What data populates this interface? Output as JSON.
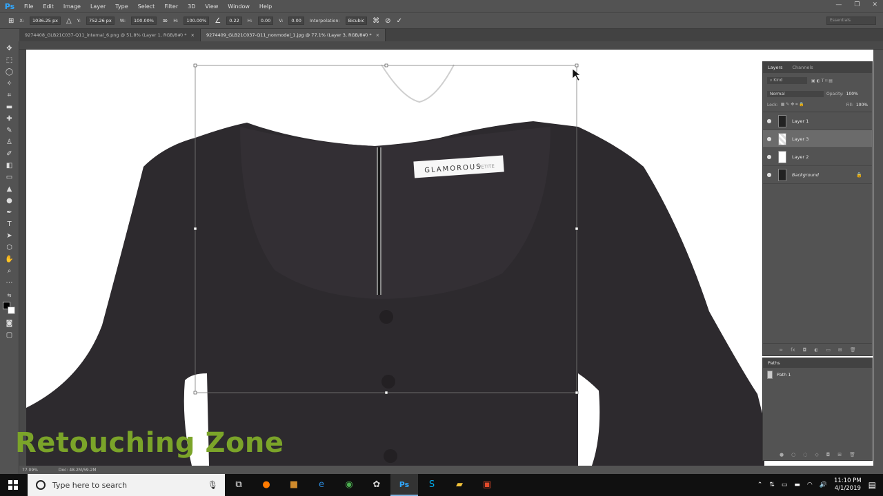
{
  "app": {
    "logo": "Ps",
    "menu": [
      "File",
      "Edit",
      "Image",
      "Layer",
      "Type",
      "Select",
      "Filter",
      "3D",
      "View",
      "Window",
      "Help"
    ],
    "window_controls": [
      "—",
      "❐",
      "✕"
    ]
  },
  "options_bar": {
    "x_label": "X:",
    "x_value": "1036.25 px",
    "y_label": "Y:",
    "y_value": "752.26 px",
    "w_label": "W:",
    "w_value": "100.00%",
    "h_label": "H:",
    "h_value": "100.00%",
    "angle_value": "0.22",
    "hskew_label": "H:",
    "hskew_value": "0.00",
    "vskew_label": "V:",
    "vskew_value": "0.00",
    "interpolation_label": "Interpolation:",
    "interpolation_value": "Bicubic",
    "workspace": "Essentials"
  },
  "tabs": [
    {
      "label": "9274408_GLB21C037-Q11_internal_6.png @ 51.8% (Layer 1, RGB/8#) *",
      "close": "×"
    },
    {
      "label": "9274409_GLB21C037-Q11_nonmodel_1.jpg @ 77.1% (Layer 3, RGB/8#) *",
      "close": "×"
    }
  ],
  "canvas": {
    "label_brand": "GLAMOROUS",
    "label_suffix": "PETITE",
    "watermark": "Retouching Zone"
  },
  "layers_panel": {
    "tabs": [
      "Layers",
      "Channels"
    ],
    "kind": "Kind",
    "blend_mode": "Normal",
    "opacity_label": "Opacity:",
    "opacity_value": "100%",
    "lock_label": "Lock:",
    "fill_label": "Fill:",
    "fill_value": "100%",
    "layers": [
      {
        "name": "Layer 1",
        "selected": false
      },
      {
        "name": "Layer 3",
        "selected": true
      },
      {
        "name": "Layer 2",
        "selected": false
      },
      {
        "name": "Background",
        "selected": false
      }
    ],
    "eye": "●"
  },
  "paths_panel": {
    "title": "Paths",
    "paths": [
      "Path 1"
    ]
  },
  "status": {
    "zoom": "77.09%",
    "doc": "Doc: 48.2M/59.2M"
  },
  "taskbar": {
    "search_placeholder": "Type here to search",
    "time": "11:10 PM",
    "date": "4/1/2019"
  },
  "colors": {
    "ps_accent": "#31a8ff",
    "watermark": "#7ba429",
    "garment": "#2d2a2e"
  }
}
